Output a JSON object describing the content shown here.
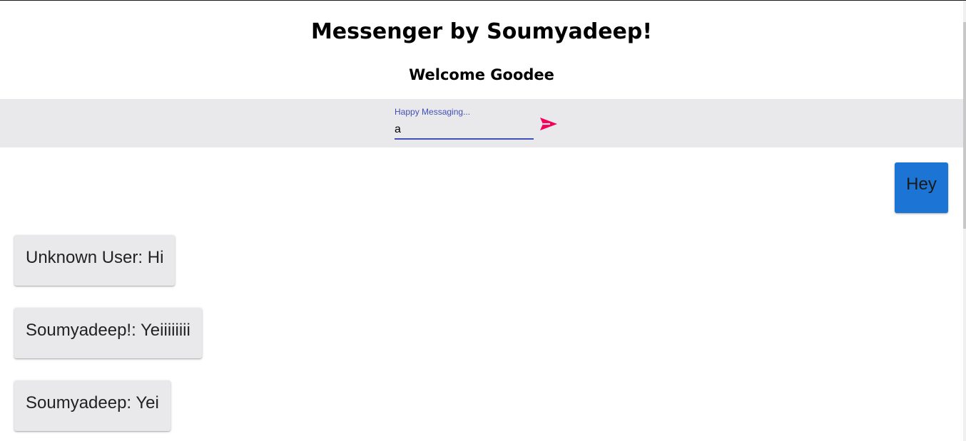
{
  "header": {
    "title": "Messenger by Soumyadeep!",
    "welcome": "Welcome Goodee"
  },
  "composer": {
    "label": "Happy Messaging...",
    "value": "a",
    "send_icon": "send-icon",
    "accent_color": "#3f51b5",
    "send_color": "#f50057"
  },
  "messages": [
    {
      "text": "Hey",
      "own": true
    },
    {
      "text": "Unknown User: Hi",
      "own": false
    },
    {
      "text": "Soumyadeep!: Yeiiiiiiii",
      "own": false
    },
    {
      "text": "Soumyadeep: Yei",
      "own": false
    }
  ],
  "colors": {
    "own_bubble": "#1c74d4",
    "other_bubble": "#e9e9ec",
    "bar_background": "#e9e9ec"
  }
}
